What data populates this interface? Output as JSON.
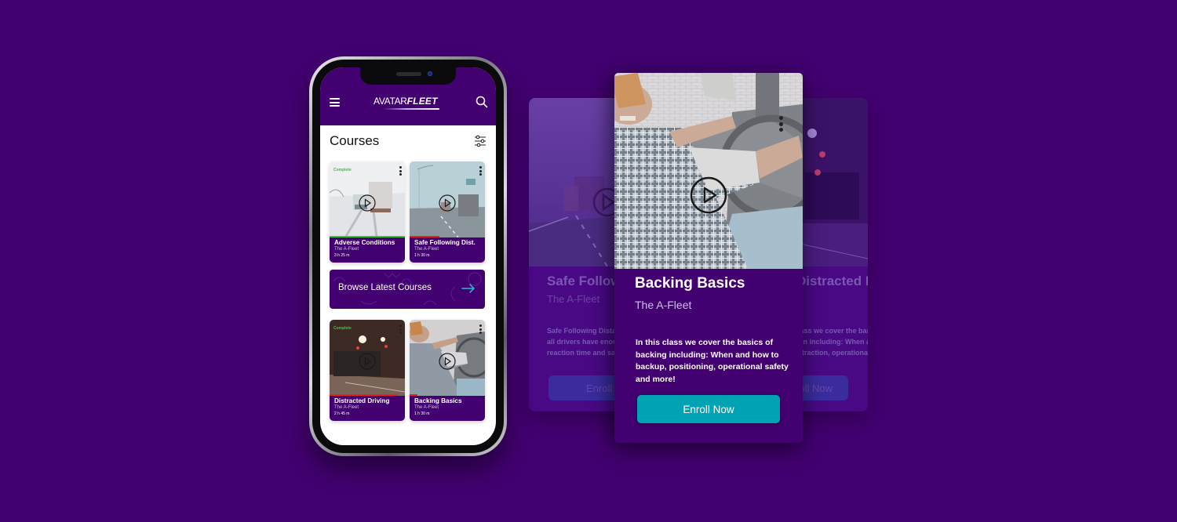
{
  "colors": {
    "background": "#420070",
    "brand_purple": "#420070",
    "accent_teal": "#00a3b4",
    "complete_green": "#3ac43a",
    "progress_red": "#e0222c"
  },
  "app": {
    "logo_part1": "AVATAR",
    "logo_part2": "FLEET",
    "menu_icon": "hamburger-icon",
    "search_icon": "search-icon"
  },
  "courses": {
    "title": "Courses",
    "filter_icon": "sliders-icon",
    "items": [
      {
        "title": "Adverse Conditions",
        "provider": "The A-Fleet",
        "duration": "3 h 25 m",
        "status": "Complete",
        "progress": 1.0,
        "progress_color": "#3ac43a"
      },
      {
        "title": "Safe Following Dist.",
        "provider": "The A-Fleet",
        "duration": "1 h 30 m",
        "status": "",
        "progress": 0.4,
        "progress_color": "#e0222c"
      },
      {
        "title": "Distracted Driving",
        "provider": "The A-Fleet",
        "duration": "2 h 45 m",
        "status": "Complete",
        "progress": 0.9,
        "progress_color": "#e0222c"
      },
      {
        "title": "Backing Basics",
        "provider": "The A-Fleet",
        "duration": "1 h 30 m",
        "status": "",
        "progress": 0.1,
        "progress_color": "#e0222c"
      }
    ],
    "browse_label": "Browse Latest Courses"
  },
  "detail_cards": {
    "left": {
      "title": "Safe Following Distance",
      "provider": "The A-Fleet",
      "description_lines": [
        "Safe Following Distance ensures",
        "all drivers have enough",
        "reaction time and safety"
      ],
      "button": "Enroll Now"
    },
    "center": {
      "title": "Backing Basics",
      "provider": "The A-Fleet",
      "description": "In this class we cover the basics of backing including: When and how to backup, positioning, operational safety and more!",
      "button": "Enroll Now"
    },
    "right": {
      "title": "Distracted Driving Basics",
      "description_lines": [
        "In this class we cover the basics of",
        "distraction including: When and how to",
        "avoid distraction, operational"
      ],
      "button": "Enroll Now"
    }
  }
}
